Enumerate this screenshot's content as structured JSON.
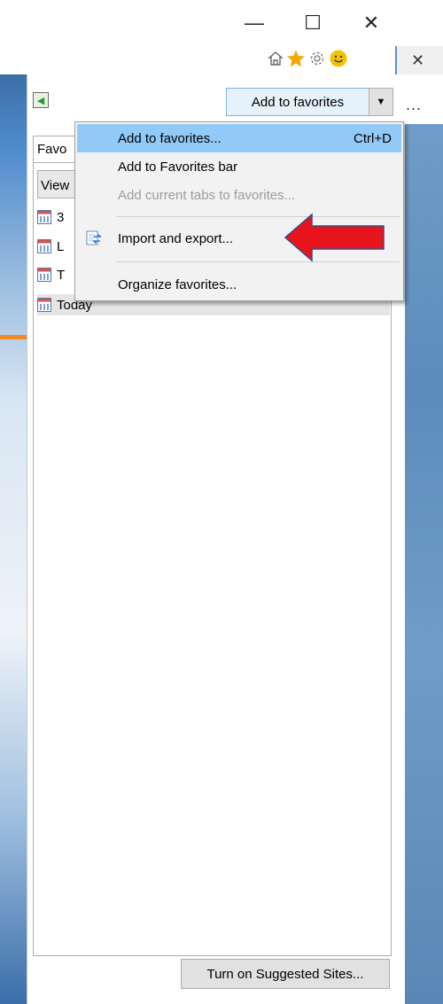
{
  "window": {
    "minimize_glyph": "—",
    "maximize_glyph": "☐",
    "close_glyph": "✕",
    "tab_close_glyph": "✕",
    "more_glyph": "..."
  },
  "toolbar": {
    "icons": [
      "home-icon",
      "favorites-star-icon",
      "settings-gear-icon",
      "feedback-smiley-icon"
    ],
    "star_color": "#f5a800",
    "smiley_color": "#f3c300"
  },
  "favorites_pane": {
    "add_button_label": "Add to favorites",
    "tab_label": "Favo",
    "view_button_label": "View",
    "history_items": [
      {
        "label": "3"
      },
      {
        "label": "L"
      },
      {
        "label": "T"
      },
      {
        "label": "Today"
      }
    ],
    "suggested_sites_label": "Turn on Suggested Sites..."
  },
  "menu": {
    "items": [
      {
        "label": "Add to favorites...",
        "shortcut": "Ctrl+D",
        "state": "highlighted"
      },
      {
        "label": "Add to Favorites bar",
        "shortcut": "",
        "state": "enabled"
      },
      {
        "label": "Add current tabs to favorites...",
        "shortcut": "",
        "state": "disabled"
      },
      {
        "label": "Import and export...",
        "shortcut": "",
        "state": "enabled",
        "icon": "import-export-icon"
      },
      {
        "label": "Organize favorites...",
        "shortcut": "",
        "state": "enabled"
      }
    ]
  },
  "annotation": {
    "arrow_color": "#e8141b",
    "points_to": "Import and export..."
  },
  "colors": {
    "highlight": "#91c9f7",
    "accent_orange": "#f08a24"
  }
}
